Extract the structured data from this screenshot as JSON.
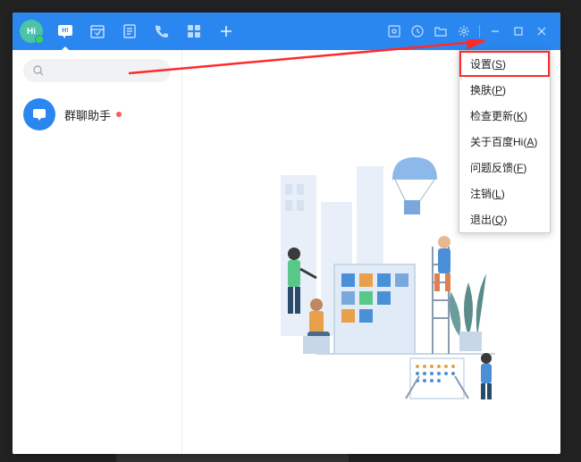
{
  "avatar_text": "Hi",
  "conversation": {
    "name": "群聊助手",
    "has_unread": true
  },
  "menu": {
    "items": [
      {
        "label": "设置",
        "hotkey": "S",
        "highlight": true
      },
      {
        "label": "换肤",
        "hotkey": "P",
        "highlight": false
      },
      {
        "label": "检查更新",
        "hotkey": "K",
        "highlight": false
      },
      {
        "label": "关于百度Hi",
        "hotkey": "A",
        "highlight": false
      },
      {
        "label": "问题反馈",
        "hotkey": "F",
        "highlight": false
      },
      {
        "label": "注销",
        "hotkey": "L",
        "highlight": false
      },
      {
        "label": "退出",
        "hotkey": "Q",
        "highlight": false
      }
    ]
  },
  "icons": {
    "chat": "chat-icon",
    "calendar": "calendar-icon",
    "contacts": "contacts-icon",
    "phone": "phone-icon",
    "apps": "apps-icon",
    "add": "add-icon",
    "screenshot": "screenshot-icon",
    "history": "history-icon",
    "folder": "folder-icon",
    "settings": "gear-icon",
    "minimize": "minimize-icon",
    "maximize": "maximize-icon",
    "close": "close-icon",
    "search": "search-icon"
  },
  "colors": {
    "brand": "#2b87f0",
    "annotation": "#ff2a2a"
  }
}
